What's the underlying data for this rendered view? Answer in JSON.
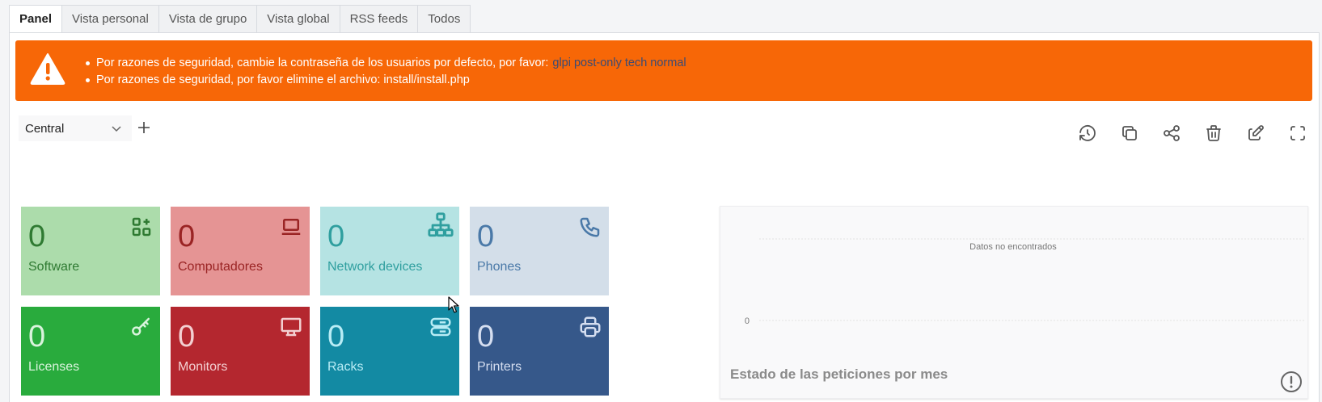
{
  "tabs": [
    {
      "label": "Panel",
      "active": true
    },
    {
      "label": "Vista personal"
    },
    {
      "label": "Vista de grupo"
    },
    {
      "label": "Vista global"
    },
    {
      "label": "RSS feeds"
    },
    {
      "label": "Todos"
    }
  ],
  "alert": {
    "line1_text": "Por razones de seguridad, cambie la contraseña de los usuarios por defecto, por favor:",
    "line1_link": "glpi post-only tech normal",
    "line2_text": "Por razones de seguridad, por favor elimine el archivo: install/install.php",
    "icon": "warning-icon"
  },
  "dashboard_select": {
    "value": "Central"
  },
  "toolbar_icons": [
    "history-icon",
    "clone-icon",
    "share-icon",
    "trash-icon",
    "edit-icon",
    "fullscreen-icon"
  ],
  "cards": [
    {
      "value": "0",
      "label": "Software",
      "icon": "apps-add-icon",
      "bg": "#acdcab",
      "fg": "#2f7a32"
    },
    {
      "value": "0",
      "label": "Computadores",
      "icon": "laptop-icon",
      "bg": "#e59494",
      "fg": "#9a2424"
    },
    {
      "value": "0",
      "label": "Network devices",
      "icon": "network-icon",
      "bg": "#b5e3e3",
      "fg": "#2f9f9f"
    },
    {
      "value": "0",
      "label": "Phones",
      "icon": "phone-icon",
      "bg": "#d3dee9",
      "fg": "#4a79a8"
    },
    {
      "value": "0",
      "label": "Licenses",
      "icon": "key-icon",
      "bg": "#29ab3d",
      "fg": "#d9f3dc"
    },
    {
      "value": "0",
      "label": "Monitors",
      "icon": "monitor-icon",
      "bg": "#b4272f",
      "fg": "#f3cfd1"
    },
    {
      "value": "0",
      "label": "Racks",
      "icon": "server-icon",
      "bg": "#138aa3",
      "fg": "#b8ecf5"
    },
    {
      "value": "0",
      "label": "Printers",
      "icon": "printer-icon",
      "bg": "#36588a",
      "fg": "#d5def0"
    }
  ],
  "chart": {
    "title": "Estado de las peticiones por mes",
    "empty_message": "Datos no encontrados",
    "y_tick": "0",
    "info_icon": "info-icon"
  },
  "chart_data": {
    "type": "bar",
    "title": "Estado de las peticiones por mes",
    "categories": [],
    "series": [],
    "yticks": [
      "0"
    ],
    "annotation": "Datos no encontrados",
    "grid": true
  }
}
